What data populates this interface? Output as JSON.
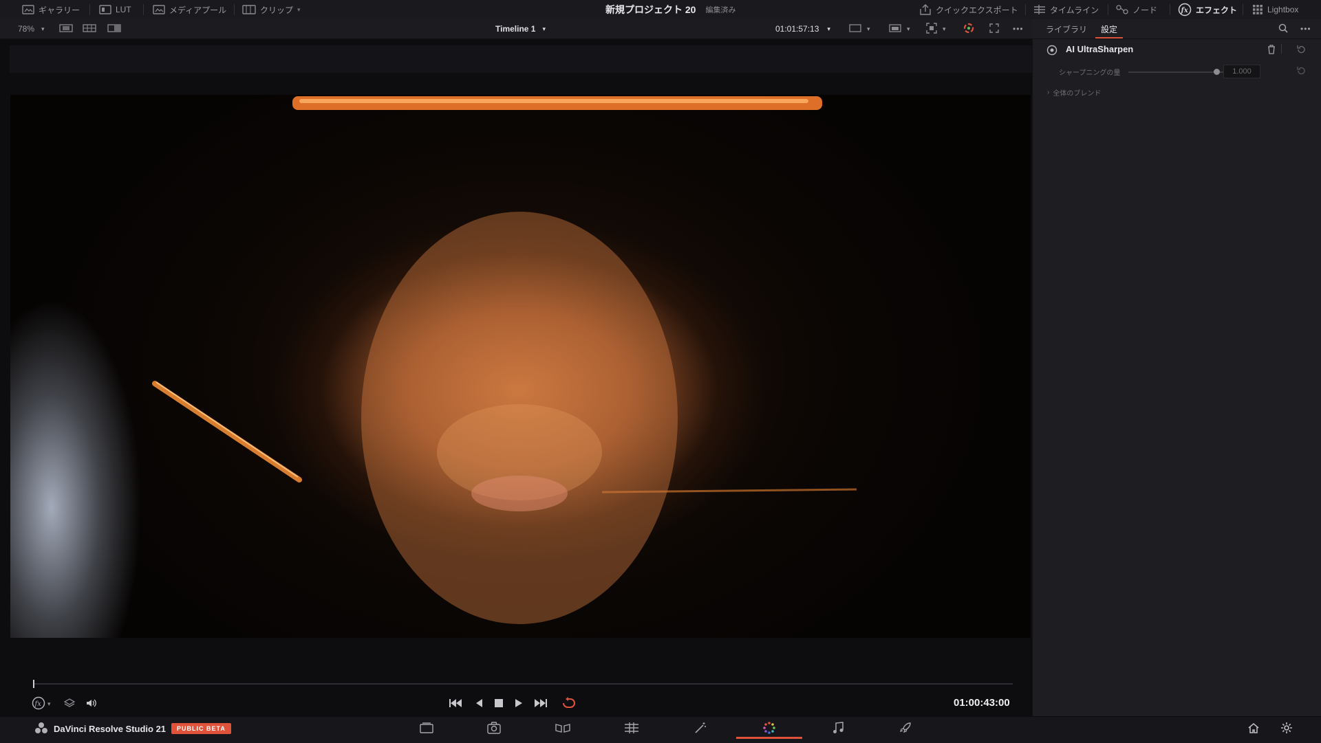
{
  "topbar": {
    "gallery_label": "ギャラリー",
    "lut_label": "LUT",
    "mediapool_label": "メディアプール",
    "clips_label": "クリップ",
    "project_title": "新規プロジェクト 20",
    "project_status": "編集済み",
    "quickexport_label": "クイックエクスポート",
    "timeline_label": "タイムライン",
    "nodes_label": "ノード",
    "effects_label": "エフェクト",
    "lightbox_label": "Lightbox"
  },
  "viewer": {
    "zoom": "78%",
    "timeline_name": "Timeline 1",
    "timecode": "01:01:57:13",
    "current_timecode": "01:00:43:00"
  },
  "inspector": {
    "tabs": [
      "ライブラリ",
      "設定"
    ],
    "active_tab": "設定",
    "effect_name": "AI UltraSharpen",
    "param_label": "シャープニングの量",
    "param_value": "1.000",
    "blend_label": "全体のブレンド"
  },
  "bottombar": {
    "app_name": "DaVinci Resolve Studio 21",
    "badge": "PUBLIC BETA",
    "pages": [
      "media",
      "cut",
      "edit",
      "fusion",
      "color",
      "fairlight",
      "deliver"
    ],
    "active_page": "color"
  },
  "colors": {
    "accent": "#e0533a",
    "panel": "#1d1d22",
    "background": "#0b0b0d"
  }
}
